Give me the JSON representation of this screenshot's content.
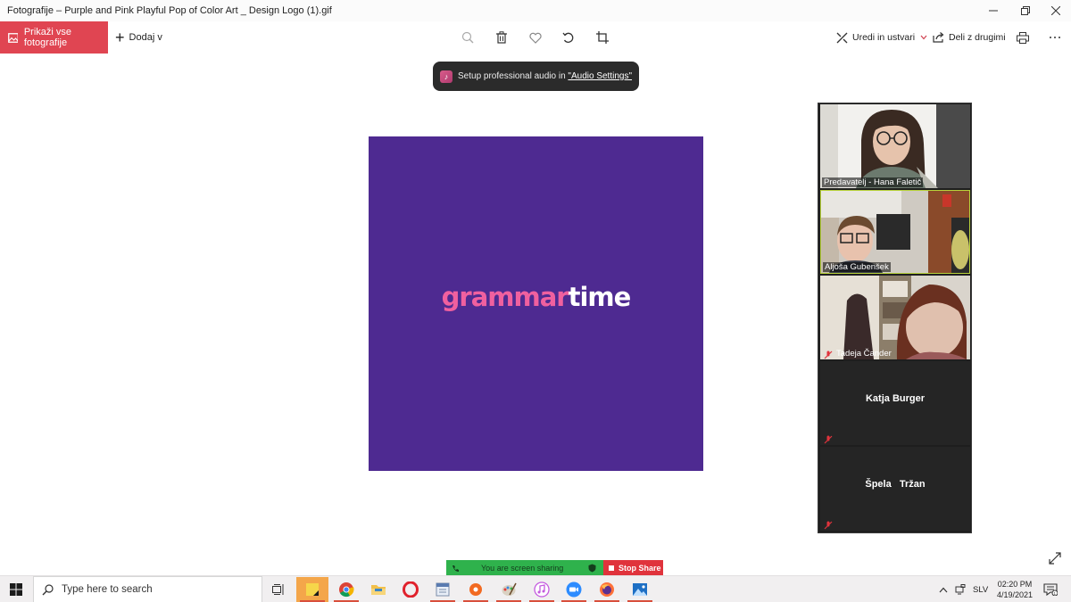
{
  "window": {
    "title": "Fotografije – Purple and Pink Playful Pop of Color Art _ Design Logo (1).gif"
  },
  "toolbar": {
    "show_all_label": "Prikaži vse fotografije",
    "add_label": "Dodaj v",
    "edit_label": "Uredi in ustvari",
    "share_label": "Deli z drugimi",
    "center_icons": [
      "zoom-icon",
      "delete-icon",
      "favorite-icon",
      "rotate-icon",
      "crop-icon"
    ]
  },
  "toast": {
    "text": "Setup professional audio in ",
    "link": "\"Audio Settings\""
  },
  "image": {
    "logo_part1": "grammar",
    "logo_part2": "time",
    "background": "#4e2a91",
    "pink": "#f0609f"
  },
  "participants": [
    {
      "name": "Predavatelj - Hana Faletič",
      "video": true
    },
    {
      "name": "Aljoša Gubenšek",
      "video": true,
      "active_speaker": true
    },
    {
      "name": "Tadeja Čander",
      "video": true,
      "muted": true
    },
    {
      "name": "Katja Burger",
      "video": false,
      "muted": true
    },
    {
      "name": "Špela   Tržan",
      "video": false,
      "muted": true
    }
  ],
  "share_bar": {
    "status": "You are screen sharing",
    "stop_label": "Stop Share"
  },
  "taskbar": {
    "search_placeholder": "Type here to search",
    "language": "SLV",
    "time": "02:20 PM",
    "date": "4/19/2021",
    "apps": [
      "task-view",
      "sticky-notes",
      "chrome",
      "file-explorer",
      "opera",
      "calendar",
      "app-orange",
      "paint",
      "itunes",
      "zoom",
      "firefox",
      "photos"
    ]
  },
  "colors": {
    "accent_red": "#e04552",
    "share_green": "#2fb24c",
    "stop_red": "#e0333c"
  }
}
